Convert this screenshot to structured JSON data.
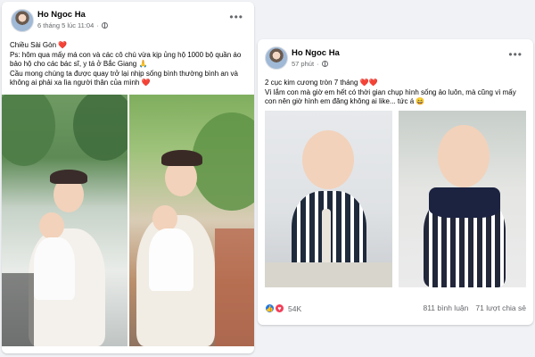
{
  "posts": [
    {
      "author": "Ho Ngoc Ha",
      "timestamp": "6 tháng 5 lúc 11:04",
      "caption_line1": "Chiều Sài Gòn ❤️",
      "caption_line2": "Ps: hôm qua mấy má con và các cô chú vừa kịp ủng hộ 1000 bộ quần áo bảo hộ cho các bác sĩ, y tá ở Bắc Giang 🙏",
      "caption_line3": "Cầu mong chúng ta được quay trở lại nhịp sống bình thường bình an và không ai phải xa lìa người thân của mình ❤️"
    },
    {
      "author": "Ho Ngoc Ha",
      "timestamp": "57 phút",
      "caption_line1": "2 cục kim cương tròn 7 tháng ❤️❤️",
      "caption_line2": "Vì lắm con mà giờ em hết có thời gian chụp hình sống ảo luôn, mà cũng vì mấy con nên giờ hình em đăng không ai like... tức á 😄",
      "reactions_count": "54K",
      "comments": "811 bình luận",
      "shares": "71 lượt chia sẻ"
    }
  ],
  "icons": {
    "more": "more-options-icon",
    "privacy": "globe-icon",
    "like": "like-reaction-icon",
    "love": "love-reaction-icon"
  },
  "colors": {
    "background": "#f0f2f5",
    "card": "#ffffff",
    "meta_text": "#65676b",
    "like_blue": "#1877f2",
    "love_red": "#f33e58"
  }
}
